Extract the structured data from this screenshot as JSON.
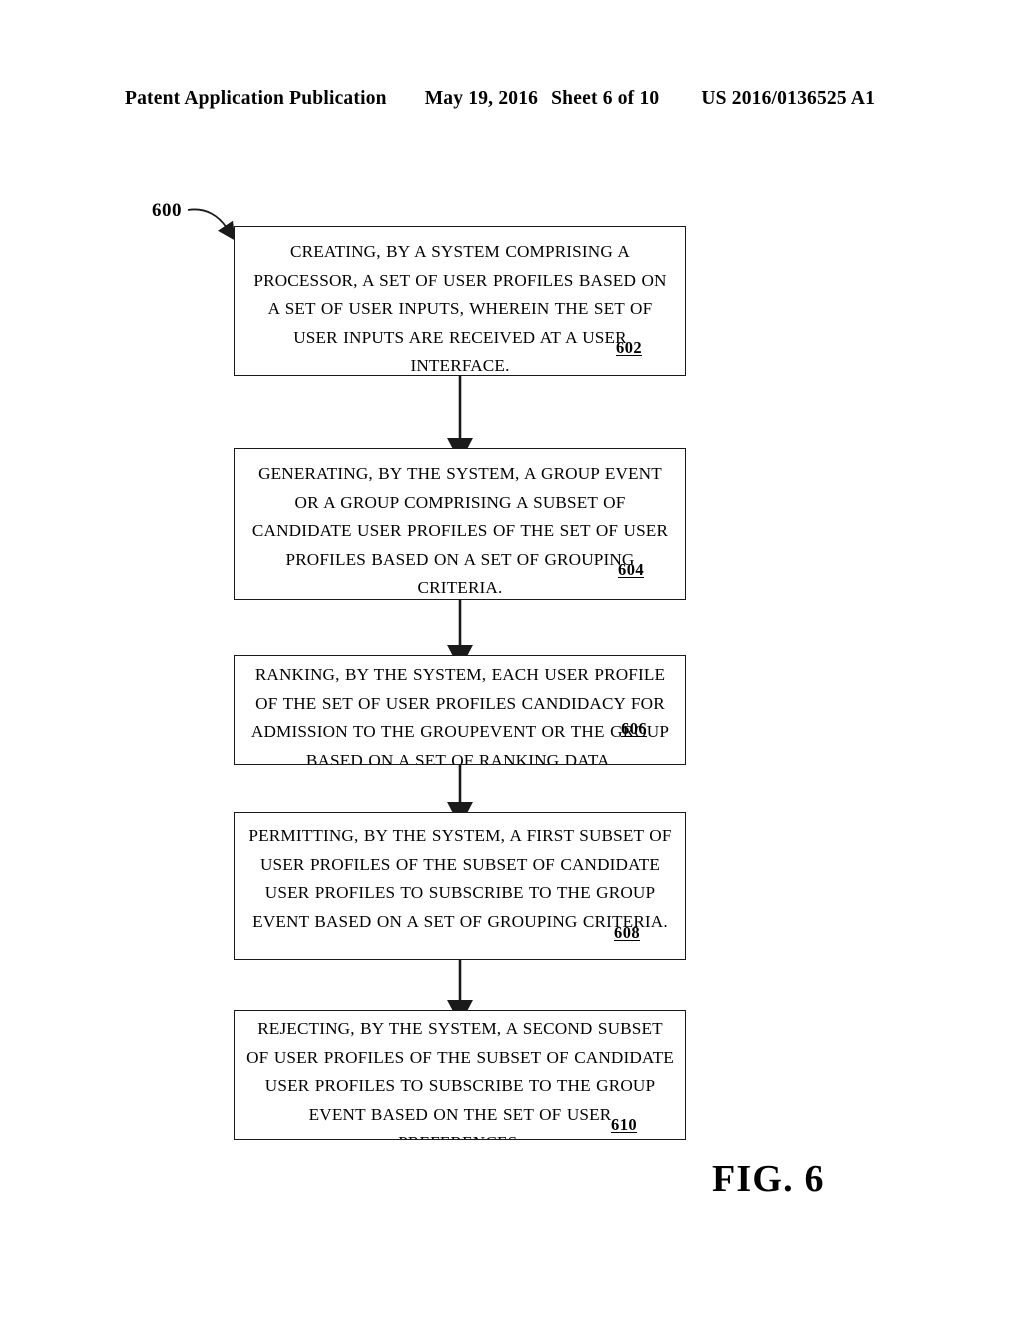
{
  "header": {
    "publication": "Patent Application Publication",
    "date": "May 19, 2016",
    "sheet": "Sheet 6 of 10",
    "publication_number": "US 2016/0136525 A1"
  },
  "figure": {
    "caption": "FIG. 6",
    "diagram_reference": "600"
  },
  "flowchart": {
    "type": "process-flow",
    "orientation": "vertical",
    "steps": [
      {
        "ref": "602",
        "text": "CREATING, BY A SYSTEM COMPRISING A PROCESSOR, A SET OF USER PROFILES BASED ON A SET OF USER INPUTS, WHEREIN THE SET OF USER INPUTS ARE RECEIVED AT A USER INTERFACE."
      },
      {
        "ref": "604",
        "text": "GENERATING, BY THE SYSTEM, A GROUP EVENT OR A GROUP COMPRISING A SUBSET OF CANDIDATE USER PROFILES OF THE SET OF USER PROFILES BASED ON A SET OF GROUPING CRITERIA."
      },
      {
        "ref": "606",
        "text": "RANKING, BY THE SYSTEM, EACH USER PROFILE OF THE SET OF USER PROFILES CANDIDACY FOR ADMISSION TO THE GROUPEVENT OR THE GROUP BASED ON A SET OF RANKING DATA."
      },
      {
        "ref": "608",
        "text": "PERMITTING, BY THE SYSTEM, A FIRST SUBSET OF USER PROFILES OF THE SUBSET OF CANDIDATE USER PROFILES TO SUBSCRIBE TO THE GROUP EVENT BASED ON A SET OF GROUPING CRITERIA."
      },
      {
        "ref": "610",
        "text": "REJECTING, BY THE SYSTEM, A SECOND SUBSET OF USER PROFILES OF THE SUBSET OF CANDIDATE USER PROFILES TO SUBSCRIBE TO THE GROUP EVENT BASED ON THE SET OF USER PREFERENCES."
      }
    ]
  },
  "colors": {
    "ink": "#000000",
    "paper": "#ffffff"
  }
}
